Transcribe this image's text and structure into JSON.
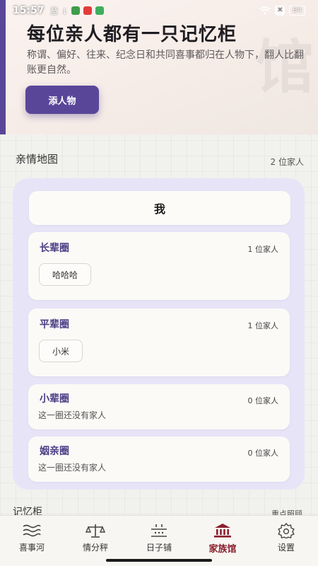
{
  "status_bar": {
    "time": "15:57",
    "notice": "意 ↓",
    "battery": "84"
  },
  "hero": {
    "title": "每位亲人都有一只记忆柜",
    "subtitle": "称谓、偏好、往来、纪念日和共同喜事都归在人物下，翻人比翻账更自然。",
    "watermark": "馆",
    "add_button": "添人物"
  },
  "family_map": {
    "title": "亲情地图",
    "count": "2 位家人",
    "me_label": "我",
    "circles": [
      {
        "name": "长辈圈",
        "count": "1 位家人",
        "members": [
          "哈哈哈"
        ],
        "empty_text": ""
      },
      {
        "name": "平辈圈",
        "count": "1 位家人",
        "members": [
          "小米"
        ],
        "empty_text": ""
      },
      {
        "name": "小辈圈",
        "count": "0 位家人",
        "members": [],
        "empty_text": "这一圈还没有家人"
      },
      {
        "name": "姻亲圈",
        "count": "0 位家人",
        "members": [],
        "empty_text": "这一圈还没有家人"
      }
    ]
  },
  "memory_cabinet": {
    "title": "记忆柜",
    "right_label": "重点照顾"
  },
  "bottom_nav": {
    "items": [
      {
        "label": "喜事河",
        "icon": "waves-icon",
        "active": false
      },
      {
        "label": "情分秤",
        "icon": "scale-icon",
        "active": false
      },
      {
        "label": "日子铺",
        "icon": "calendar-grid-icon",
        "active": false
      },
      {
        "label": "家族馆",
        "icon": "museum-icon",
        "active": true
      },
      {
        "label": "设置",
        "icon": "gear-icon",
        "active": false
      }
    ]
  },
  "colors": {
    "accent": "#5a4699",
    "active_nav": "#8a1f2e",
    "panel": "#e8e4f8"
  }
}
